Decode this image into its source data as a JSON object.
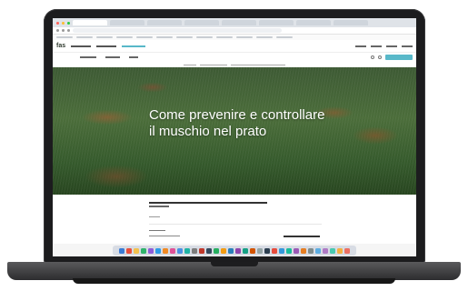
{
  "site": {
    "logo": "fas"
  },
  "hero": {
    "title": "Come prevenire e controllare il muschio nel prato"
  },
  "colors": {
    "cta": "#58b8c9",
    "laptop_body": "#1c1c1e"
  },
  "dock": {
    "icon_colors": [
      "#3a7bd5",
      "#e94e3c",
      "#f2c14e",
      "#2fb36b",
      "#8e5cd9",
      "#2e9ce6",
      "#f08a24",
      "#e05297",
      "#4a90e2",
      "#1fb3a5",
      "#7d7d7d",
      "#c0392b",
      "#34495e",
      "#27ae60",
      "#f39c12",
      "#2980b9",
      "#8e44ad",
      "#16a085",
      "#d35400",
      "#95a5a6",
      "#2c3e50",
      "#e74c3c",
      "#3498db",
      "#1abc9c",
      "#9b59b6",
      "#e67e22",
      "#7f8c8d",
      "#5dade2",
      "#af7ac5",
      "#48c9b0",
      "#f5b041",
      "#ec7063"
    ]
  }
}
